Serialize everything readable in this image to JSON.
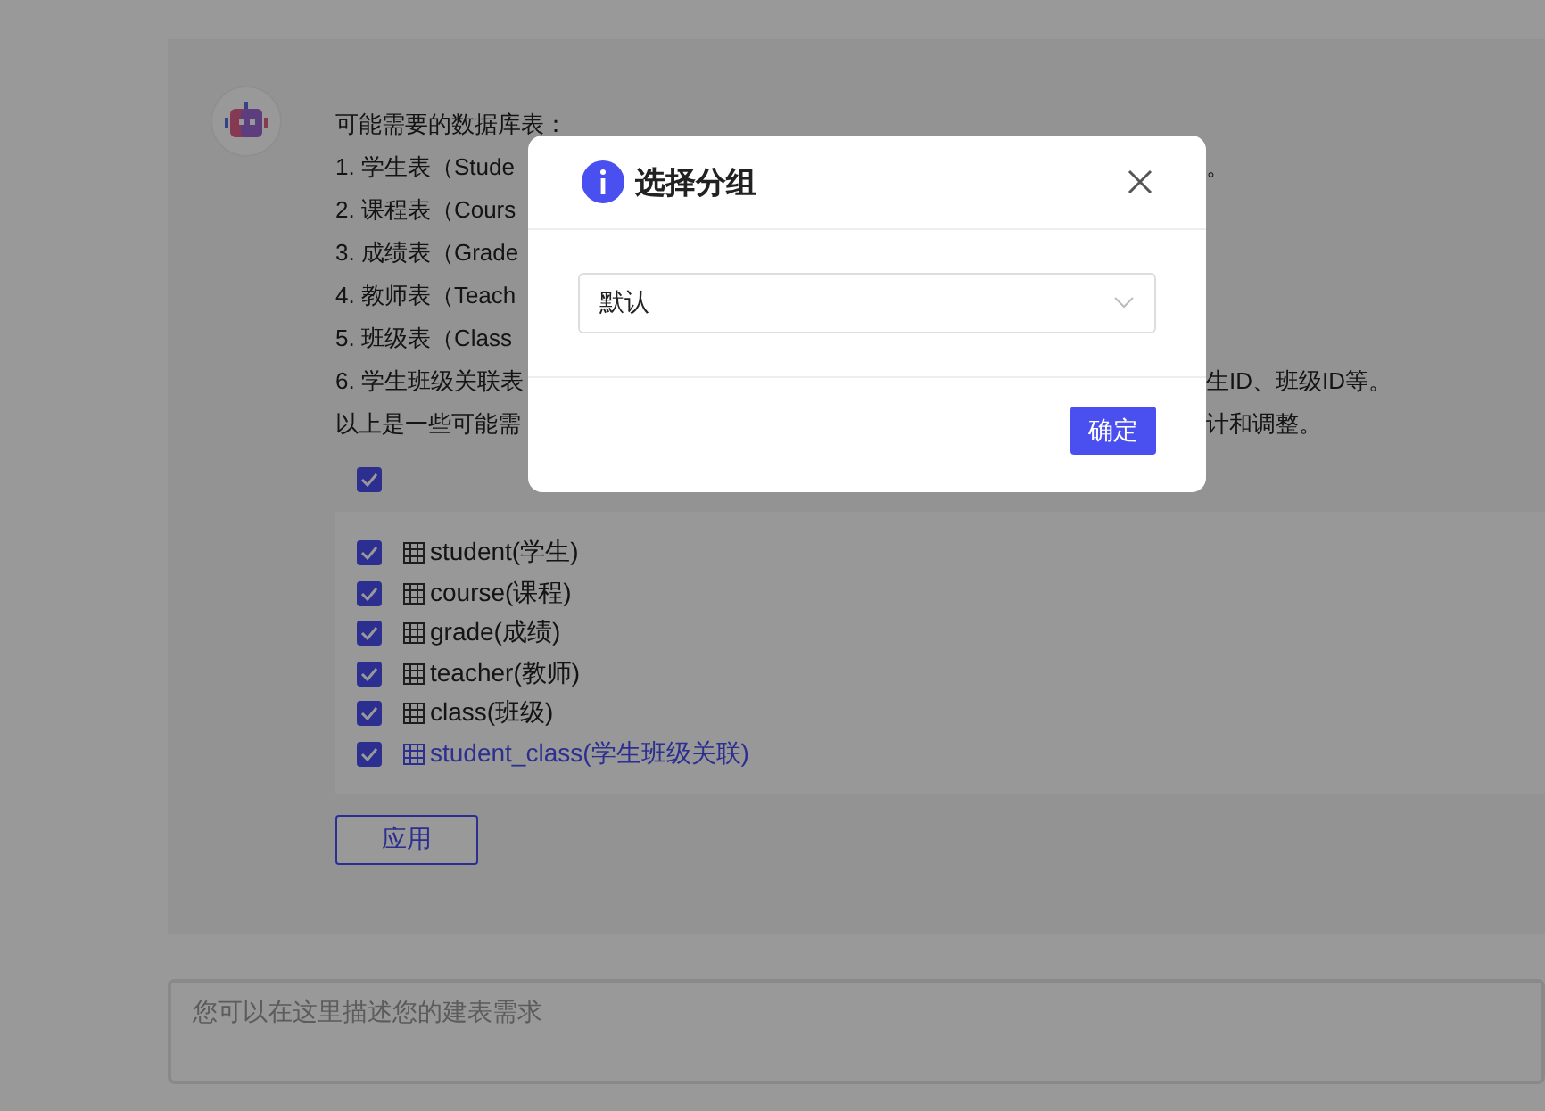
{
  "message": {
    "lines": [
      {
        "left": "可能需要的数据库表："
      },
      {
        "left": "1. 学生表（Stude",
        "right": "。"
      },
      {
        "left": "2. 课程表（Cours"
      },
      {
        "left": "3. 成绩表（Grade"
      },
      {
        "left": "4. 教师表（Teach"
      },
      {
        "left": "5. 班级表（Class"
      },
      {
        "left": "6. 学生班级关联表",
        "right": "生ID、班级ID等。"
      },
      {
        "left": "以上是一些可能需",
        "right": "计和调整。"
      }
    ],
    "select_all": {
      "checked": true
    },
    "tables": [
      {
        "label": "student(学生)",
        "checked": true,
        "selected": false
      },
      {
        "label": "course(课程)",
        "checked": true,
        "selected": false
      },
      {
        "label": "grade(成绩)",
        "checked": true,
        "selected": false
      },
      {
        "label": "teacher(教师)",
        "checked": true,
        "selected": false
      },
      {
        "label": "class(班级)",
        "checked": true,
        "selected": false
      },
      {
        "label": "student_class(学生班级关联)",
        "checked": true,
        "selected": true
      }
    ],
    "apply_button": "应用"
  },
  "input": {
    "placeholder": "您可以在这里描述您的建表需求"
  },
  "dialog": {
    "title": "选择分组",
    "select": {
      "value": "默认"
    },
    "confirm_button": "确定"
  }
}
